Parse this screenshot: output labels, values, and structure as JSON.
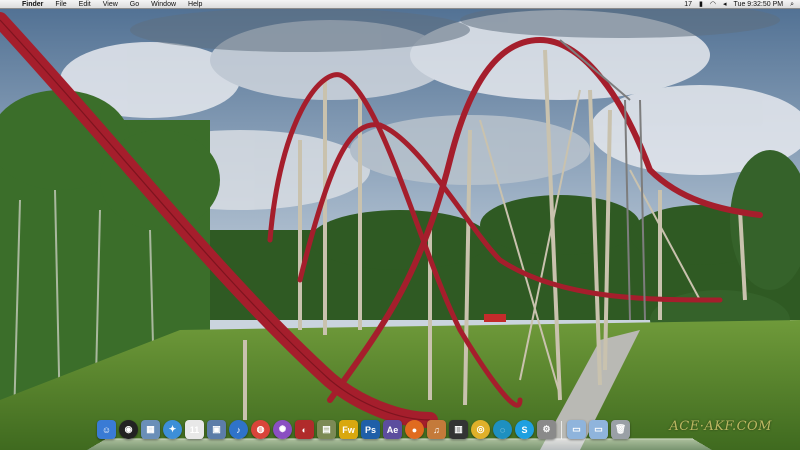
{
  "menubar": {
    "apple_glyph": "",
    "app_name": "Finder",
    "menus": [
      "File",
      "Edit",
      "View",
      "Go",
      "Window",
      "Help"
    ],
    "status": {
      "app_indicator": "17",
      "battery_glyph": "▮",
      "wifi_glyph": "◠",
      "volume_glyph": "◂",
      "clock": "Tue 9:32:50 PM",
      "search_glyph": "⌕"
    }
  },
  "watermark": "ACE·AKF.COM",
  "dock": {
    "apps": [
      {
        "name": "finder-icon",
        "glyph": "☺",
        "color": "#3a7bd5"
      },
      {
        "name": "dashboard-icon",
        "glyph": "◉",
        "color": "#222222"
      },
      {
        "name": "preview-icon",
        "glyph": "▦",
        "color": "#6a8fb8"
      },
      {
        "name": "safari-icon",
        "glyph": "✦",
        "color": "#3d8fd8"
      },
      {
        "name": "ical-icon",
        "glyph": "11",
        "color": "#e8e8e8"
      },
      {
        "name": "iphoto-icon",
        "glyph": "▣",
        "color": "#5c7da8"
      },
      {
        "name": "itunes-icon",
        "glyph": "♪",
        "color": "#2f73c9"
      },
      {
        "name": "chrome-like-icon",
        "glyph": "◍",
        "color": "#d9443a"
      },
      {
        "name": "color-wheel-icon",
        "glyph": "✺",
        "color": "#8a4fc2"
      },
      {
        "name": "photo-booth-icon",
        "glyph": "◐",
        "color": "#b02b2b"
      },
      {
        "name": "image-viewer-icon",
        "glyph": "▤",
        "color": "#7c8a55"
      },
      {
        "name": "fireworks-icon",
        "glyph": "Fw",
        "color": "#d9a80f"
      },
      {
        "name": "photoshop-icon",
        "glyph": "Ps",
        "color": "#1f5fa8"
      },
      {
        "name": "after-effects-icon",
        "glyph": "Ae",
        "color": "#5c4d9e"
      },
      {
        "name": "firefox-icon",
        "glyph": "●",
        "color": "#e06b1f"
      },
      {
        "name": "guitar-icon",
        "glyph": "♫",
        "color": "#c47a3a"
      },
      {
        "name": "clapperboard-icon",
        "glyph": "▥",
        "color": "#333333"
      },
      {
        "name": "chrome-icon",
        "glyph": "◎",
        "color": "#e0b02a"
      },
      {
        "name": "quicktime-icon",
        "glyph": "◌",
        "color": "#1e90c0"
      },
      {
        "name": "skype-icon",
        "glyph": "S",
        "color": "#1fa0e0"
      },
      {
        "name": "system-preferences-icon",
        "glyph": "⚙",
        "color": "#8a8a8a"
      }
    ],
    "folders": [
      {
        "name": "applications-folder-icon",
        "glyph": "▭",
        "color": "#8fb4dc"
      },
      {
        "name": "documents-folder-icon",
        "glyph": "▭",
        "color": "#8fb4dc"
      }
    ],
    "trash": {
      "name": "trash-icon",
      "glyph": "🗑",
      "color": "#9aa0a6"
    }
  }
}
